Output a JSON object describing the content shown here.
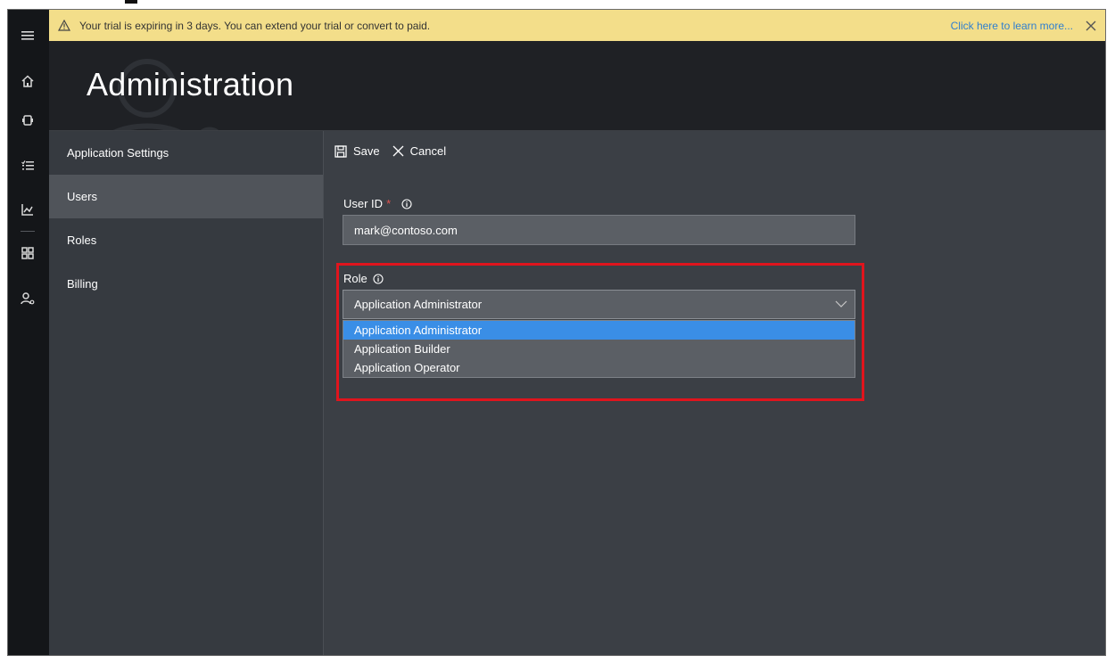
{
  "banner": {
    "icon": "warning-icon",
    "message": "Your trial is expiring in 3 days. You can extend your trial or convert to paid.",
    "link": "Click here to learn more...",
    "background": "#f3de8a",
    "link_color": "#2f7fd0"
  },
  "rail": {
    "icons": [
      "hamburger-icon",
      "home-icon",
      "device-icon",
      "rules-icon",
      "analytics-icon",
      "dashboard-grid-icon",
      "admin-users-icon"
    ]
  },
  "page": {
    "title": "Administration"
  },
  "nav": {
    "items": [
      {
        "label": "Application Settings",
        "selected": false
      },
      {
        "label": "Users",
        "selected": true
      },
      {
        "label": "Roles",
        "selected": false
      },
      {
        "label": "Billing",
        "selected": false
      }
    ]
  },
  "toolbar": {
    "save_label": "Save",
    "cancel_label": "Cancel"
  },
  "form": {
    "user_id_label": "User ID",
    "required_mark": "*",
    "user_id_value": "mark@contoso.com",
    "role_label": "Role",
    "role_selected": "Application Administrator",
    "role_options": [
      "Application Administrator",
      "Application Builder",
      "Application Operator"
    ],
    "highlight_color": "#e0141d",
    "active_option_color": "#3a8ee6"
  }
}
